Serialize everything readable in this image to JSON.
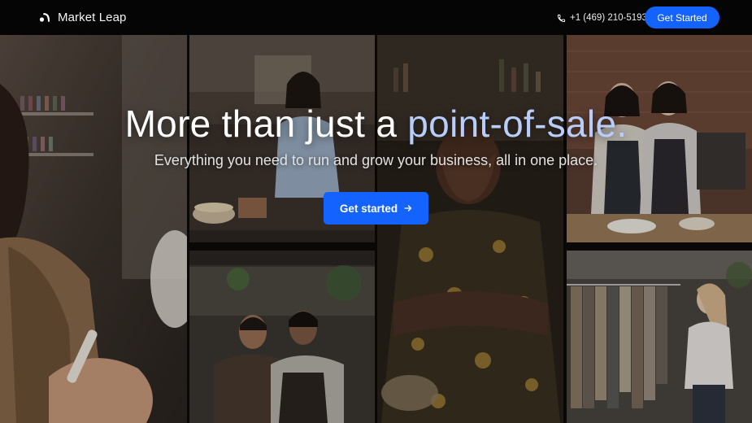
{
  "nav": {
    "brand_name": "Market Leap",
    "brand_icon": "market-leap-logo-icon",
    "phone": "+1 (469) 210-5193",
    "phone_icon": "phone-icon",
    "cta_label": "Get Started"
  },
  "hero": {
    "headline_lead": "More than just a ",
    "headline_accent": "point-of-sale.",
    "subheadline": "Everything you need to run and grow your business, all in one place.",
    "cta_label": "Get started",
    "cta_icon": "arrow-right-icon",
    "photos": [
      "nail-salon-photo",
      "bakery-counter-photo",
      "cafe-owners-photo",
      "shop-owner-arms-crossed-photo",
      "restaurant-staff-photo",
      "clothing-boutique-photo"
    ]
  },
  "colors": {
    "brand_blue": "#1463ff",
    "headline_accent": "#b9cdfa",
    "nav_background": "#050505"
  }
}
